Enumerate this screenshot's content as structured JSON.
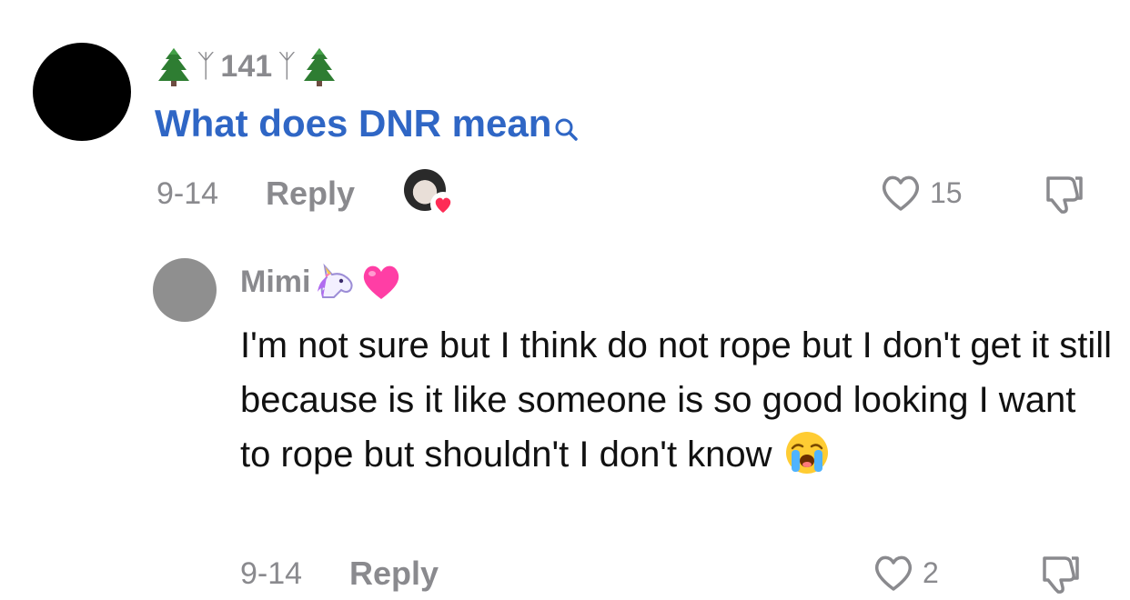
{
  "comment": {
    "username_count": "141",
    "username_rune": "ᛉ",
    "text": "What does DNR mean",
    "date": "9-14",
    "reply_label": "Reply",
    "likes": "15",
    "icons": [
      "tree-icon",
      "search-icon",
      "heart-outline-icon",
      "thumbs-down-icon",
      "creator-liked-badge"
    ]
  },
  "reply": {
    "username": "Mimi",
    "text": "I'm not sure but I think do not rope but I don't get it still because is it like someone is so good looking I want to rope but shouldn't I don't know",
    "date": "9-14",
    "reply_label": "Reply",
    "likes": "2",
    "icons": [
      "unicorn-icon",
      "pink-heart-icon",
      "crying-face-icon",
      "heart-outline-icon",
      "thumbs-down-icon"
    ]
  },
  "colors": {
    "link_blue": "#2f66c5",
    "meta_grey": "#8a8a8e",
    "text": "#111111",
    "like_red": "#fe2c55"
  }
}
